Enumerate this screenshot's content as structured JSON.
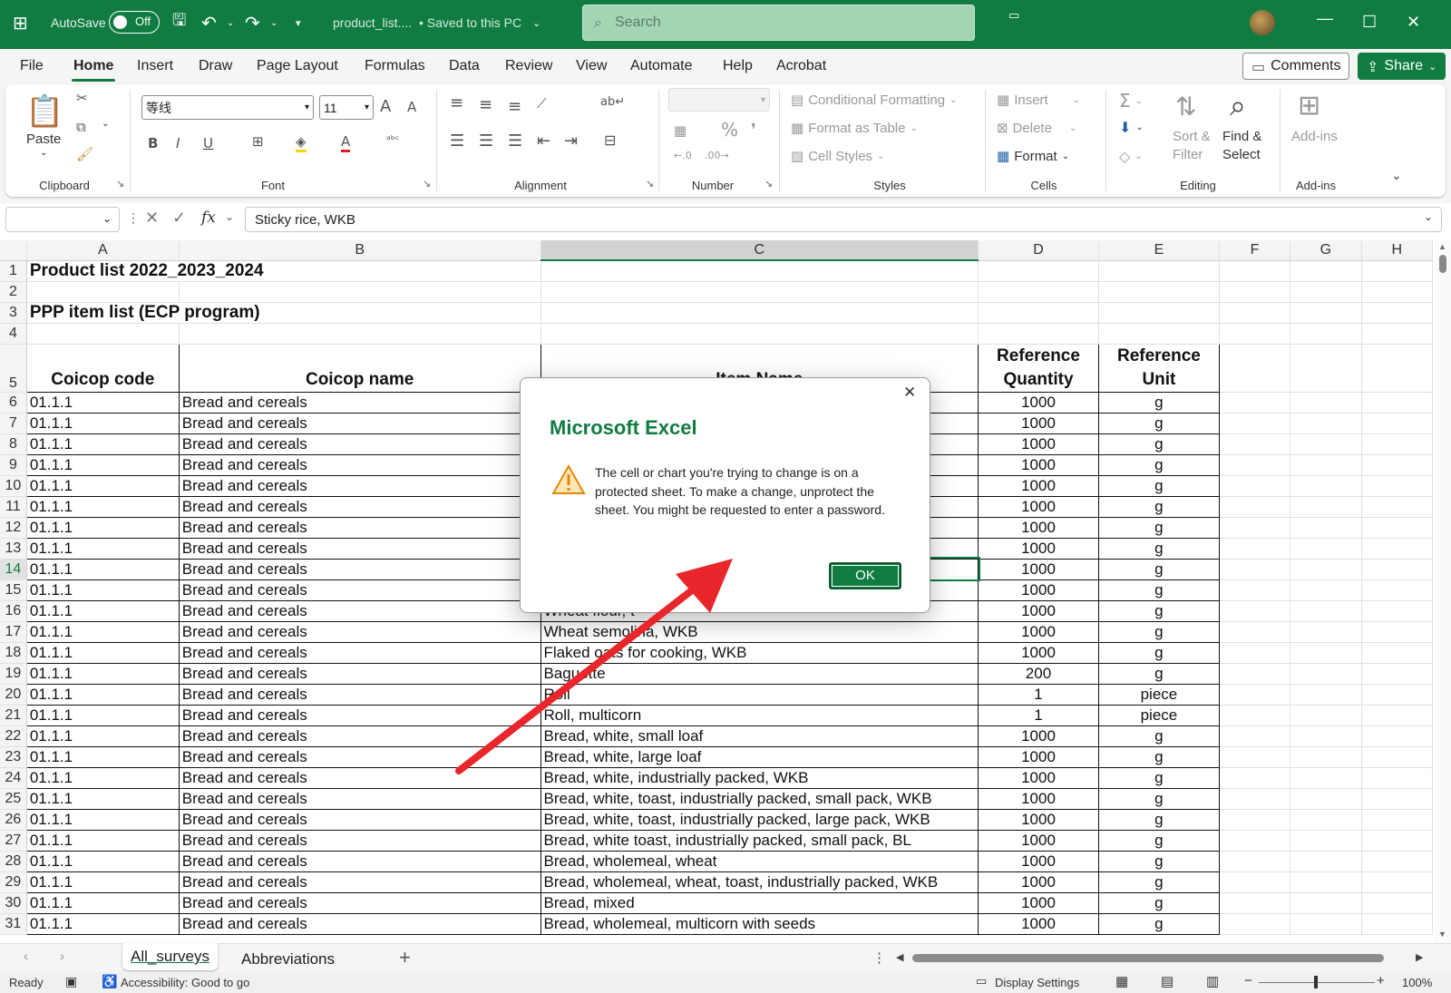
{
  "titlebar": {
    "autosave_label": "AutoSave",
    "autosave_state": "Off",
    "filename": "product_list....",
    "save_status": "• Saved to this PC",
    "search_placeholder": "Search"
  },
  "menu": {
    "tabs": [
      "File",
      "Home",
      "Insert",
      "Draw",
      "Page Layout",
      "Formulas",
      "Data",
      "Review",
      "View",
      "Automate",
      "Help",
      "Acrobat"
    ],
    "comments": "Comments",
    "share": "Share"
  },
  "ribbon": {
    "paste": "Paste",
    "clipboard": "Clipboard",
    "font_name": "等线",
    "font_size": "11",
    "font": "Font",
    "alignment": "Alignment",
    "number": "Number",
    "cond_format": "Conditional Formatting",
    "format_table": "Format as Table",
    "cell_styles": "Cell Styles",
    "styles": "Styles",
    "insert": "Insert",
    "delete": "Delete",
    "format": "Format",
    "cells": "Cells",
    "sort_filter_1": "Sort &",
    "sort_filter_2": "Filter",
    "find_select_1": "Find &",
    "find_select_2": "Select",
    "editing": "Editing",
    "addins": "Add-ins",
    "addins_group": "Add-ins"
  },
  "formula_bar": {
    "fx": "fx",
    "content": "Sticky rice, WKB"
  },
  "columns": [
    "A",
    "B",
    "C",
    "D",
    "E",
    "F",
    "G",
    "H"
  ],
  "title1": "Product list 2022_2023_2024",
  "title3": "PPP item list (ECP program)",
  "headers": {
    "a": "Coicop code",
    "b": "Coicop name",
    "c": "Item Name",
    "d": "Reference Quantity",
    "e": "Reference Unit"
  },
  "rows": [
    {
      "n": "6",
      "code": "01.1.1",
      "name": "Bread and cereals",
      "item": "",
      "qty": "1000",
      "unit": "g"
    },
    {
      "n": "7",
      "code": "01.1.1",
      "name": "Bread and cereals",
      "item": "",
      "qty": "1000",
      "unit": "g"
    },
    {
      "n": "8",
      "code": "01.1.1",
      "name": "Bread and cereals",
      "item": "",
      "qty": "1000",
      "unit": "g"
    },
    {
      "n": "9",
      "code": "01.1.1",
      "name": "Bread and cereals",
      "item": "",
      "qty": "1000",
      "unit": "g"
    },
    {
      "n": "10",
      "code": "01.1.1",
      "name": "Bread and cereals",
      "item": "",
      "qty": "1000",
      "unit": "g"
    },
    {
      "n": "11",
      "code": "01.1.1",
      "name": "Bread and cereals",
      "item": "",
      "qty": "1000",
      "unit": "g"
    },
    {
      "n": "12",
      "code": "01.1.1",
      "name": "Bread and cereals",
      "item": "",
      "qty": "1000",
      "unit": "g"
    },
    {
      "n": "13",
      "code": "01.1.1",
      "name": "Bread and cereals",
      "item": "",
      "qty": "1000",
      "unit": "g"
    },
    {
      "n": "14",
      "code": "01.1.1",
      "name": "Bread and cereals",
      "item": "",
      "qty": "1000",
      "unit": "g"
    },
    {
      "n": "15",
      "code": "01.1.1",
      "name": "Bread and cereals",
      "item": "",
      "qty": "1000",
      "unit": "g"
    },
    {
      "n": "16",
      "code": "01.1.1",
      "name": "Bread and cereals",
      "item": "Wheat flour, t",
      "qty": "1000",
      "unit": "g"
    },
    {
      "n": "17",
      "code": "01.1.1",
      "name": "Bread and cereals",
      "item": "Wheat semolina, WKB",
      "qty": "1000",
      "unit": "g"
    },
    {
      "n": "18",
      "code": "01.1.1",
      "name": "Bread and cereals",
      "item": "Flaked oats for cooking, WKB",
      "qty": "1000",
      "unit": "g"
    },
    {
      "n": "19",
      "code": "01.1.1",
      "name": "Bread and cereals",
      "item": "Baguette",
      "qty": "200",
      "unit": "g"
    },
    {
      "n": "20",
      "code": "01.1.1",
      "name": "Bread and cereals",
      "item": "Roll",
      "qty": "1",
      "unit": "piece"
    },
    {
      "n": "21",
      "code": "01.1.1",
      "name": "Bread and cereals",
      "item": "Roll, multicorn",
      "qty": "1",
      "unit": "piece"
    },
    {
      "n": "22",
      "code": "01.1.1",
      "name": "Bread and cereals",
      "item": "Bread, white, small loaf",
      "qty": "1000",
      "unit": "g"
    },
    {
      "n": "23",
      "code": "01.1.1",
      "name": "Bread and cereals",
      "item": "Bread, white, large loaf",
      "qty": "1000",
      "unit": "g"
    },
    {
      "n": "24",
      "code": "01.1.1",
      "name": "Bread and cereals",
      "item": "Bread, white, industrially packed, WKB",
      "qty": "1000",
      "unit": "g"
    },
    {
      "n": "25",
      "code": "01.1.1",
      "name": "Bread and cereals",
      "item": "Bread, white, toast, industrially packed, small pack, WKB",
      "qty": "1000",
      "unit": "g"
    },
    {
      "n": "26",
      "code": "01.1.1",
      "name": "Bread and cereals",
      "item": "Bread, white, toast, industrially packed, large pack, WKB",
      "qty": "1000",
      "unit": "g"
    },
    {
      "n": "27",
      "code": "01.1.1",
      "name": "Bread and cereals",
      "item": "Bread, white toast, industrially packed, small pack, BL",
      "qty": "1000",
      "unit": "g"
    },
    {
      "n": "28",
      "code": "01.1.1",
      "name": "Bread and cereals",
      "item": "Bread, wholemeal, wheat",
      "qty": "1000",
      "unit": "g"
    },
    {
      "n": "29",
      "code": "01.1.1",
      "name": "Bread and cereals",
      "item": "Bread, wholemeal, wheat, toast, industrially packed, WKB",
      "qty": "1000",
      "unit": "g"
    },
    {
      "n": "30",
      "code": "01.1.1",
      "name": "Bread and cereals",
      "item": "Bread, mixed",
      "qty": "1000",
      "unit": "g"
    },
    {
      "n": "31",
      "code": "01.1.1",
      "name": "Bread and cereals",
      "item": "Bread, wholemeal, multicorn with seeds",
      "qty": "1000",
      "unit": "g"
    }
  ],
  "sheets": {
    "active": "All_surveys",
    "other": "Abbreviations"
  },
  "status": {
    "ready": "Ready",
    "accessibility": "Accessibility: Good to go",
    "display": "Display Settings",
    "zoom": "100%"
  },
  "dialog": {
    "title": "Microsoft Excel",
    "message": "The cell or chart you're trying to change is on a protected sheet. To make a change, unprotect the sheet. You might be requested to enter a password.",
    "ok": "OK"
  },
  "colors": {
    "excel_green": "#107c41",
    "arrow_red": "#e8262b"
  }
}
